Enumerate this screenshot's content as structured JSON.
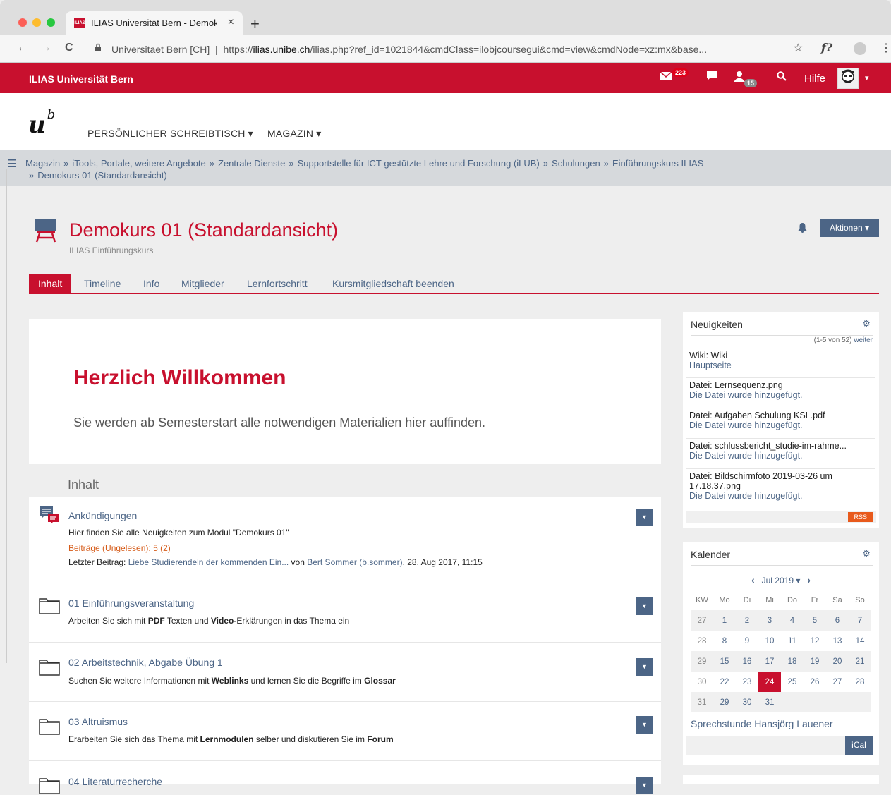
{
  "browser": {
    "tab_title": "ILIAS Universität Bern - Demok",
    "tab_favicon": "ILIAS",
    "close_icon": "×",
    "new_tab": "+",
    "back": "←",
    "forward": "→",
    "reload": "C",
    "url_origin": "Universitaet Bern [CH]",
    "url_prefix": "https://",
    "url_host": "ilias.unibe.ch",
    "url_path": "/ilias.php?ref_id=1021844&cmdClass=ilobjcoursegui&cmd=view&cmdNode=xz:mx&base...",
    "star": "☆",
    "ext": "f?",
    "menu": "⋮"
  },
  "topbar": {
    "brand": "ILIAS Universität Bern",
    "mail_count": "223",
    "contacts_count": "15",
    "help": "Hilfe"
  },
  "header": {
    "logo": "u",
    "logo_sup": "b",
    "nav_desk": "PERSÖNLICHER SCHREIBTISCH ▾",
    "nav_magazin": "MAGAZIN ▾"
  },
  "breadcrumbs": {
    "items": [
      "Magazin",
      "iTools, Portale, weitere Angebote",
      "Zentrale Dienste",
      "Supportstelle für ICT-gestützte Lehre und Forschung (iLUB)",
      "Schulungen",
      "Einführungskurs ILIAS"
    ],
    "last": "Demokurs 01 (Standardansicht)",
    "sep": "»"
  },
  "page": {
    "title": "Demokurs 01 (Standardansicht)",
    "subtitle": "ILIAS Einführungskurs",
    "actions": "Aktionen ▾"
  },
  "tabs": [
    "Inhalt",
    "Timeline",
    "Info",
    "Mitglieder",
    "Lernfortschritt",
    "Kursmitgliedschaft beenden"
  ],
  "welcome": {
    "heading": "Herzlich Willkommen",
    "text": "Sie werden ab Semesterstart alle notwendigen Materialien hier auffinden."
  },
  "content": {
    "section_title": "Inhalt",
    "items": [
      {
        "title": "Ankündigungen",
        "desc": "Hier finden Sie alle Neuigkeiten zum Modul \"Demokurs 01\"",
        "unread": "Beiträge (Ungelesen): 5 (2)",
        "last_label": "Letzter Beitrag:",
        "last_link": "Liebe Studierendeln der kommenden Ein...",
        "last_by": " von ",
        "last_author": "Bert Sommer (b.sommer)",
        "last_date": ", 28. Aug 2017, 11:15"
      },
      {
        "title": "01 Einführungsveranstaltung",
        "d1": "Arbeiten Sie sich mit ",
        "b1": "PDF",
        "d2": " Texten und ",
        "b2": "Video",
        "d3": "-Erklärungen in das Thema ein"
      },
      {
        "title": "02 Arbeitstechnik, Abgabe Übung 1",
        "d1": "Suchen Sie weitere Informationen mit ",
        "b1": "Weblinks",
        "d2": " und lernen Sie die Begriffe im ",
        "b2": "Glossar",
        "d3": ""
      },
      {
        "title": "03 Altruismus",
        "d1": "Erarbeiten Sie sich das Thema mit ",
        "b1": "Lernmodulen",
        "d2": " selber und diskutieren Sie im ",
        "b2": "Forum",
        "d3": ""
      },
      {
        "title": "04 Literaturrecherche"
      }
    ]
  },
  "news": {
    "title": "Neuigkeiten",
    "count": "(1-5 von 52)",
    "more": "weiter",
    "entries": [
      {
        "l1": "Wiki: Wiki",
        "l2": "Hauptseite"
      },
      {
        "l1": "Datei: Lernsequenz.png",
        "l2": "Die Datei wurde hinzugefügt."
      },
      {
        "l1": "Datei: Aufgaben Schulung KSL.pdf",
        "l2": "Die Datei wurde hinzugefügt."
      },
      {
        "l1": "Datei: schlussbericht_studie-im-rahme...",
        "l2": "Die Datei wurde hinzugefügt."
      },
      {
        "l1": "Datei: Bildschirmfoto 2019-03-26 um",
        "l1b": "17.18.37.png",
        "l2": "Die Datei wurde hinzugefügt."
      }
    ],
    "rss": "RSS"
  },
  "calendar": {
    "title": "Kalender",
    "month": "Jul 2019 ▾",
    "prev": "‹",
    "next": "›",
    "headers": [
      "KW",
      "Mo",
      "Di",
      "Mi",
      "Do",
      "Fr",
      "Sa",
      "So"
    ],
    "weeks": [
      [
        "27",
        "1",
        "2",
        "3",
        "4",
        "5",
        "6",
        "7"
      ],
      [
        "28",
        "8",
        "9",
        "10",
        "11",
        "12",
        "13",
        "14"
      ],
      [
        "29",
        "15",
        "16",
        "17",
        "18",
        "19",
        "20",
        "21"
      ],
      [
        "30",
        "22",
        "23",
        "24",
        "25",
        "26",
        "27",
        "28"
      ],
      [
        "31",
        "29",
        "30",
        "31",
        "",
        "",
        "",
        ""
      ]
    ],
    "event": "Sprechstunde Hansjörg Lauener",
    "ical": "iCal"
  },
  "colors": {
    "brand": "#c8102e",
    "link": "#4c6586",
    "orange": "#e85a1c"
  }
}
